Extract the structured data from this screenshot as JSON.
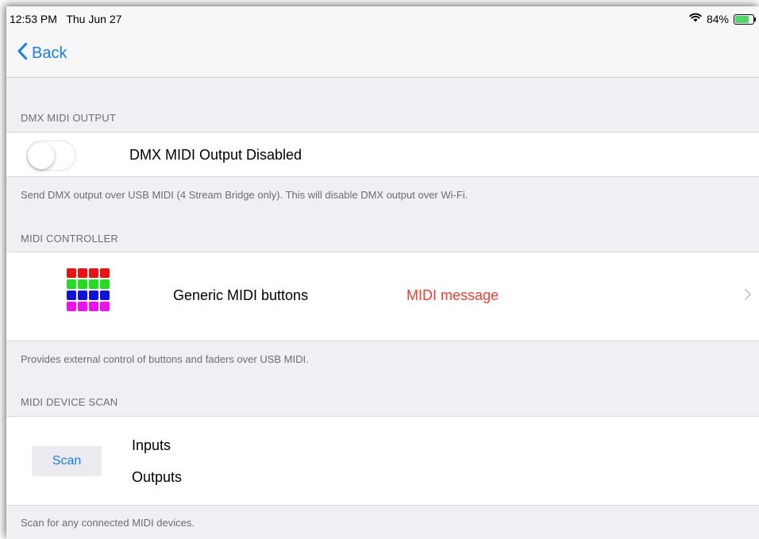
{
  "status_bar": {
    "time": "12:53 PM   Thu Jun 27",
    "battery_percent": "84%",
    "battery_level": 0.84,
    "battery_color": "#4cd964"
  },
  "nav": {
    "back_label": "Back",
    "accent": "#157efb"
  },
  "dmx_section": {
    "header": "DMX MIDI OUTPUT",
    "toggle_on": false,
    "toggle_label": "DMX MIDI Output Disabled",
    "footer": "Send DMX output over USB MIDI (4 Stream Bridge only). This will disable DMX output over Wi-Fi."
  },
  "controller_section": {
    "header": "MIDI CONTROLLER",
    "icon_name": "midi-button-grid-icon",
    "icon_rows": [
      "#ee1111",
      "#22dd22",
      "#1111dd",
      "#ee11ee"
    ],
    "controller_name": "Generic MIDI buttons",
    "message": "MIDI message",
    "message_color": "#ff3b30",
    "footer": "Provides external control of buttons and faders over USB MIDI."
  },
  "scan_section": {
    "header": "MIDI DEVICE SCAN",
    "scan_button": "Scan",
    "inputs_label": "Inputs",
    "outputs_label": "Outputs",
    "footer": "Scan for any connected MIDI devices."
  }
}
